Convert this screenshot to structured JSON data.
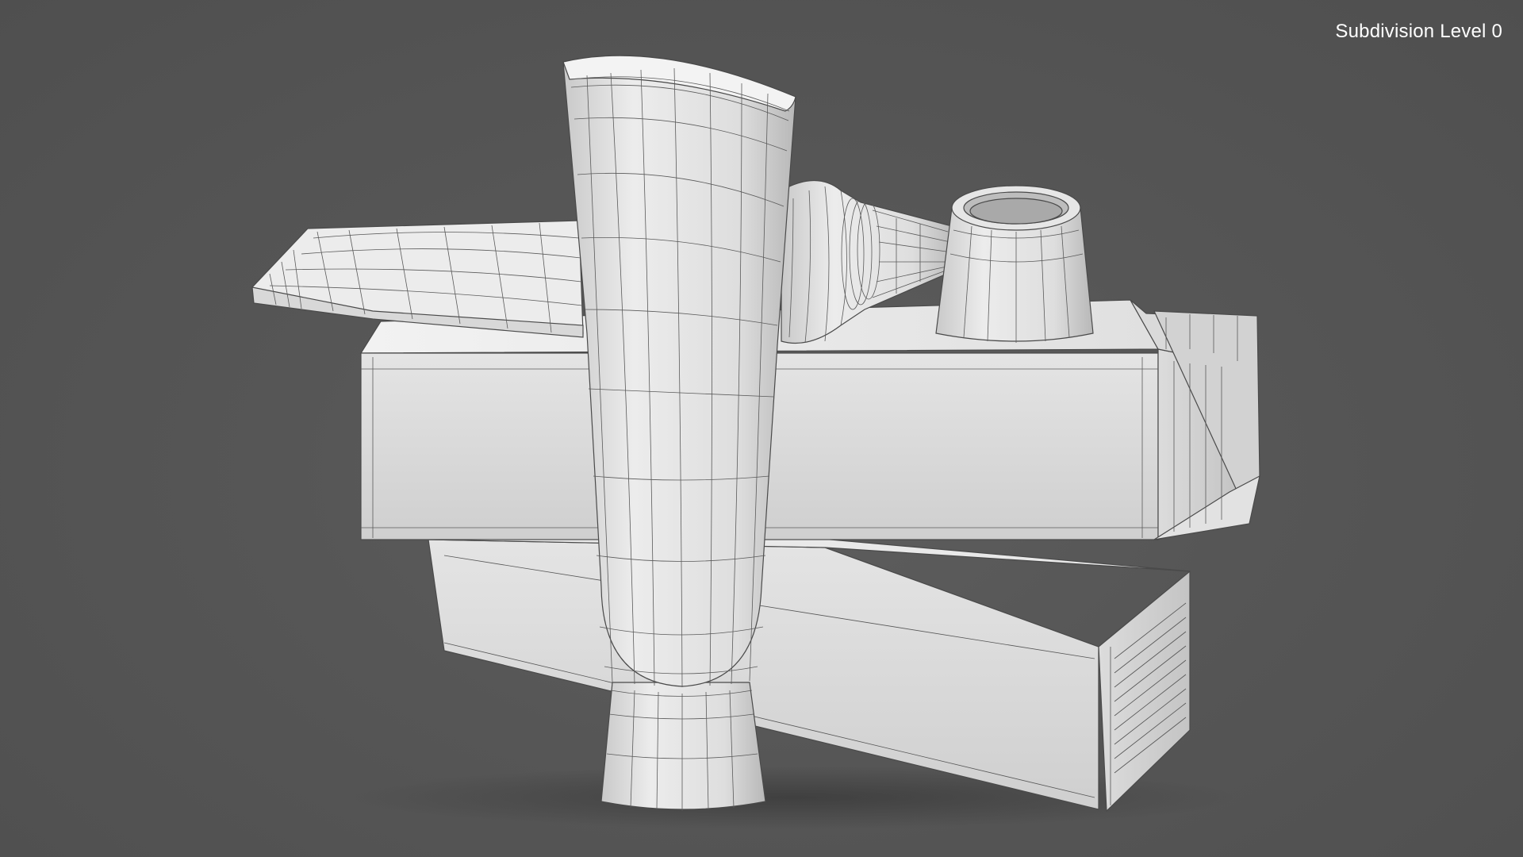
{
  "viewport": {
    "overlay_label": "Subdivision Level 0",
    "background_color": "#545454",
    "model_color": "#e6e6e6",
    "wire_color": "#3a3a3a"
  },
  "scene": {
    "objects": [
      "standing-tube",
      "lying-tube",
      "upper-box",
      "lower-box"
    ]
  }
}
